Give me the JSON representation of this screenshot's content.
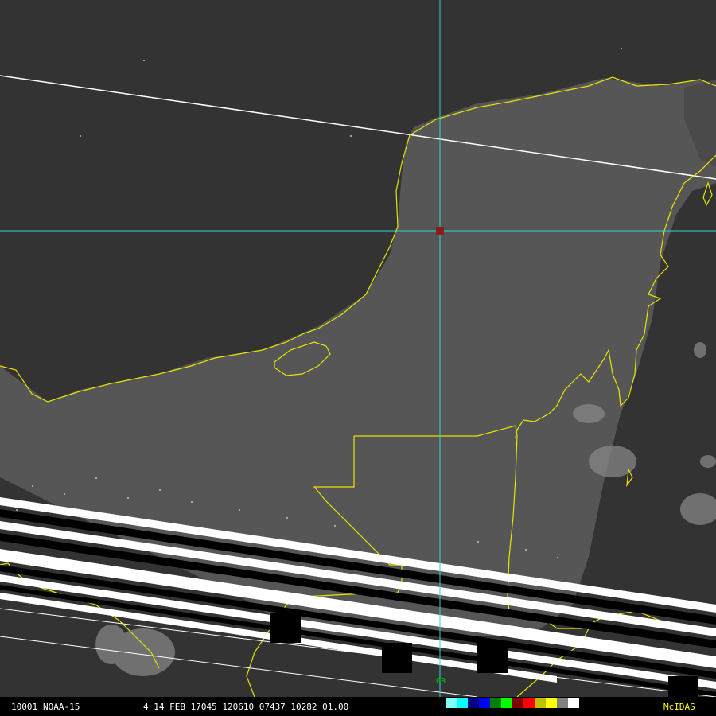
{
  "image": {
    "satellite": "NOAA-15",
    "frame": "10001",
    "info_line": "4 14 FEB 17045 120610 07437 10282 01.00",
    "software": "McIDAS",
    "cursor_label": "00"
  },
  "colors": {
    "background": "#3c3c3c",
    "ocean": "#333333",
    "land": "#555555",
    "coastline": "#e8e400",
    "crosshair": "#2dd4e0",
    "cursor_marker": "#8b1a1a",
    "orbit_track": "#ffffff",
    "brand_text": "#ffff00"
  },
  "palette": [
    "#000000",
    "#1a1a1a",
    "#333333",
    "#4d4d4d",
    "#666666",
    "#808080",
    "#999999",
    "#b3b3b3",
    "#cccccc",
    "#e6e6e6",
    "#ffffff",
    "#80ffff",
    "#00ffff",
    "#000080",
    "#0000ff",
    "#008000",
    "#00ff00",
    "#800000",
    "#ff0000",
    "#c0c000",
    "#ffff00",
    "#808080",
    "#ffffff"
  ]
}
